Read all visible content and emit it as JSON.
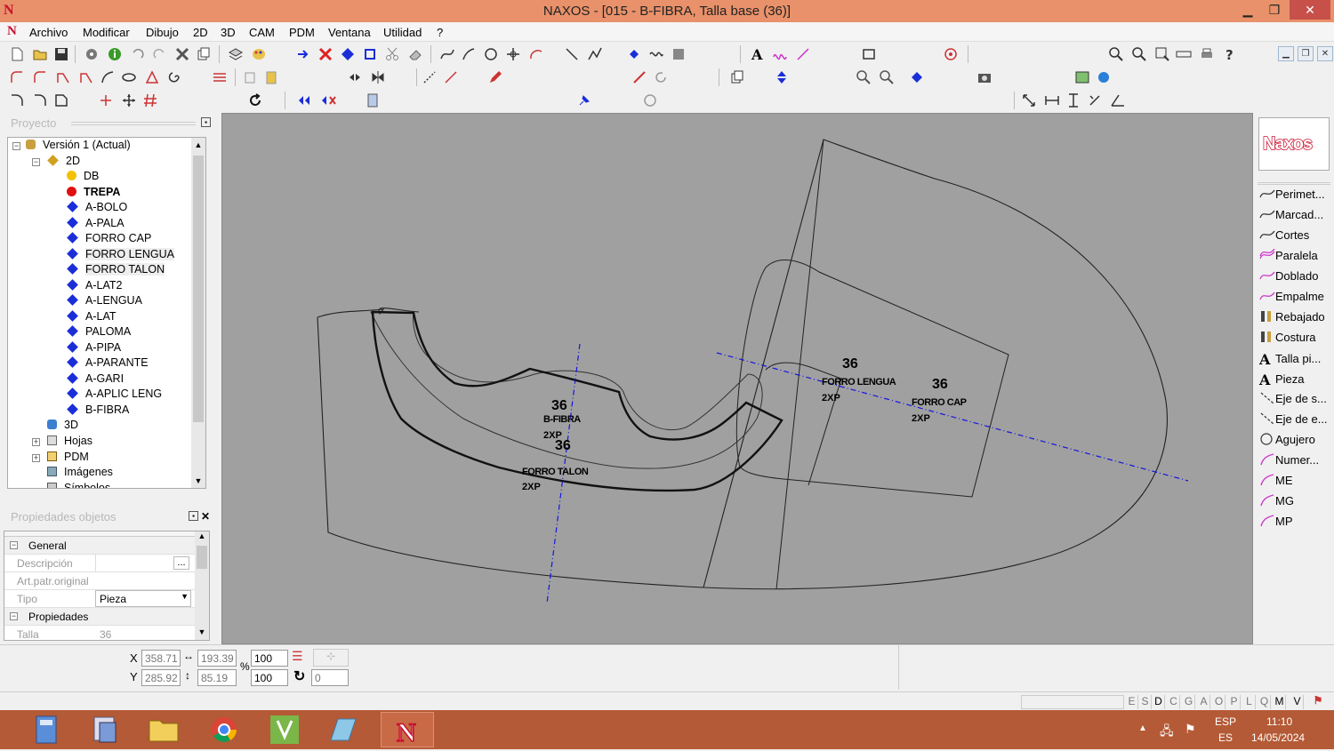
{
  "window": {
    "title": "NAXOS - [015 - B-FIBRA, Talla base (36)]",
    "controls": {
      "minimize": "▁",
      "maximize": "❐",
      "close": "✕"
    }
  },
  "menu": [
    "Archivo",
    "Modificar",
    "Dibujo",
    "2D",
    "3D",
    "CAM",
    "PDM",
    "Ventana",
    "Utilidad",
    "?"
  ],
  "project_panel": {
    "title": "Proyecto",
    "tree": {
      "root": "Versión 1 (Actual)",
      "node_2d": "2D",
      "db": "DB",
      "trepa": "TREPA",
      "pieces": [
        "A-BOLO",
        "A-PALA",
        "FORRO CAP",
        "FORRO LENGUA",
        "FORRO TALON",
        "A-LAT2",
        "A-LENGUA",
        "A-LAT",
        "PALOMA",
        "A-PIPA",
        "A-PARANTE",
        "A-GARI",
        "A-APLIC LENG",
        "B-FIBRA"
      ],
      "node_3d": "3D",
      "hojas": "Hojas",
      "pdm": "PDM",
      "imagenes": "Imágenes",
      "simbolos": "Símbolos"
    }
  },
  "properties_panel": {
    "title": "Propiedades objetos",
    "general": "General",
    "descripcion_label": "Descripción",
    "descripcion_btn": "...",
    "art_label": "Art.patr.original",
    "tipo_label": "Tipo",
    "tipo_value": "Pieza",
    "propiedades": "Propiedades",
    "talla_label": "Talla",
    "talla_value": "36"
  },
  "canvas": {
    "labels": [
      {
        "size": "36",
        "name": "B-FIBRA",
        "qty": "2XP"
      },
      {
        "size": "36",
        "name": "FORRO TALON",
        "qty": "2XP"
      },
      {
        "size": "36",
        "name": "FORRO LENGUA",
        "qty": "2XP"
      },
      {
        "size": "36",
        "name": "FORRO CAP",
        "qty": "2XP"
      }
    ]
  },
  "right_panel": {
    "logo": "Naxos",
    "tools": [
      "Perimet...",
      "Marcad...",
      "Cortes",
      "Paralela",
      "Doblado",
      "Empalme",
      "Rebajado",
      "Costura",
      "Talla pi...",
      "Pieza",
      "Eje de s...",
      "Eje de e...",
      "Agujero",
      "Numer...",
      "ME",
      "MG",
      "MP"
    ]
  },
  "coords": {
    "x_label": "X",
    "y_label": "Y",
    "x": "358.71",
    "y": "285.92",
    "width": "193.39",
    "height": "85.19",
    "pct_label": "%",
    "scale_x": "100",
    "scale_y": "100",
    "angle": "0"
  },
  "status_letters": [
    "E",
    "S",
    "D",
    "C",
    "G",
    "A",
    "O",
    "P",
    "L",
    "Q",
    "M",
    "V"
  ],
  "taskbar": {
    "lang1": "ESP",
    "lang2": "ES",
    "time": "11:10",
    "date": "14/05/2024"
  }
}
